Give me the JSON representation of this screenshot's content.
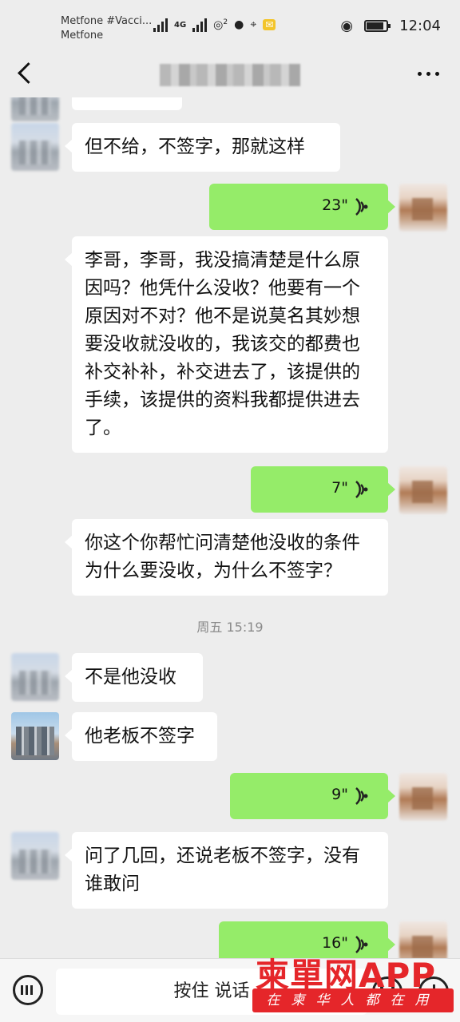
{
  "status_bar": {
    "carrier_line1": "Metfone #Vacci...",
    "carrier_line2": "Metfone",
    "network_label": "4G",
    "sim_label": "R",
    "hotspot_count": "2",
    "battery_percent": 85,
    "time": "12:04"
  },
  "nav": {
    "back_icon": "chevron-left-icon",
    "more_icon": "ellipsis-icon"
  },
  "messages": [
    {
      "side": "left",
      "type": "text",
      "text": "但不给，不签字，那就这样"
    },
    {
      "side": "right",
      "type": "voice",
      "duration": "23\""
    },
    {
      "side": "left",
      "type": "text",
      "text": "李哥，李哥，我没搞清楚是什么原因吗？他凭什么没收？他要有一个原因对不对？他不是说莫名其妙想要没收就没收的，我该交的都费也补交补补，补交进去了，该提供的手续，该提供的资料我都提供进去了。"
    },
    {
      "side": "right",
      "type": "voice",
      "duration": "7\""
    },
    {
      "side": "left",
      "type": "text",
      "text": "你这个你帮忙问清楚他没收的条件为什么要没收，为什么不签字？"
    },
    {
      "type": "time",
      "text": "周五 15:19"
    },
    {
      "side": "left",
      "type": "text",
      "text": "不是他没收"
    },
    {
      "side": "left",
      "type": "text",
      "text": "他老板不签字"
    },
    {
      "side": "right",
      "type": "voice",
      "duration": "9\""
    },
    {
      "side": "left",
      "type": "text",
      "text": "问了几回，还说老板不签字，没有谁敢问"
    },
    {
      "side": "right",
      "type": "voice",
      "duration": "16\""
    }
  ],
  "input_bar": {
    "keyboard_icon": "keyboard-icon",
    "hold_to_talk": "按住 说话",
    "emoji_icon": "emoji-icon",
    "plus_icon": "plus-icon"
  },
  "watermark": {
    "main": "柬單网APP",
    "sub": "在柬华人都在用"
  },
  "colors": {
    "chat_bg": "#ededed",
    "voice_bubble": "#95ec69",
    "text_bubble": "#ffffff",
    "watermark_red": "#e5262a"
  }
}
